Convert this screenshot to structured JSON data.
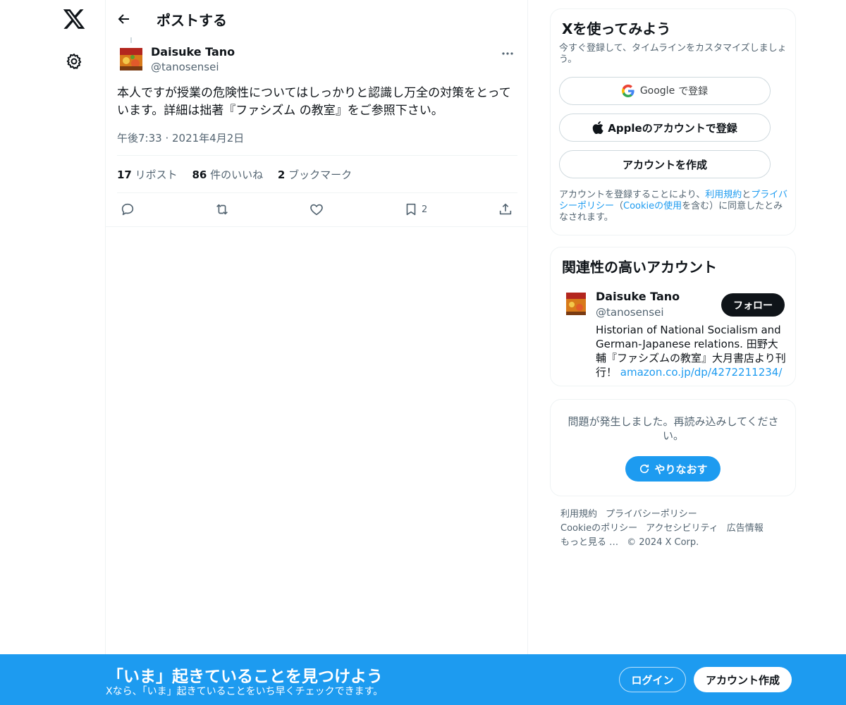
{
  "header": {
    "title": "ポストする"
  },
  "post": {
    "author_name": "Daisuke Tano",
    "author_handle": "@tanosensei",
    "text": "本人ですが授業の危険性についてはしっかりと認識し万全の対策をとっています。詳細は拙著『ファシズム の教室』をご参照下さい。",
    "timestamp": "午後7:33 · 2021年4月2日",
    "reposts_count": "17",
    "reposts_label": "リポスト",
    "likes_count": "86",
    "likes_label": "件のいいね",
    "bookmarks_count": "2",
    "bookmarks_label": "ブックマーク",
    "bookmark_action_count": "2"
  },
  "signup_card": {
    "title": "Xを使ってみよう",
    "subtitle": "今すぐ登録して、タイムラインをカスタマイズしましょう。",
    "google_brand": "Google",
    "google_label": "で登録",
    "apple_label": "Appleのアカウントで登録",
    "create_label": "アカウントを作成",
    "terms_prefix": "アカウントを登録することにより、",
    "terms_link": "利用規約",
    "terms_and": "と",
    "privacy_link": "プライバシーポリシー",
    "terms_mid": "（",
    "cookie_link": "Cookieの使用",
    "terms_suffix": "を含む）に同意したとみなされます。"
  },
  "related_card": {
    "title": "関連性の高いアカウント",
    "name": "Daisuke Tano",
    "handle": "@tanosensei",
    "follow_label": "フォロー",
    "bio": "Historian of National Socialism and German-Japanese relations. 田野大輔『ファシズムの教室』大月書店より刊行！",
    "bio_link": "amazon.co.jp/dp/4272211234/"
  },
  "error_card": {
    "message": "問題が発生しました。再読み込みしてください。",
    "retry_label": "やりなおす"
  },
  "footer": {
    "terms": "利用規約",
    "privacy": "プライバシーポリシー",
    "cookie": "Cookieのポリシー",
    "accessibility": "アクセシビリティ",
    "ads": "広告情報",
    "more": "もっと見る …",
    "copyright": "© 2024 X Corp."
  },
  "banner": {
    "title": "「いま」起きていることを見つけよう",
    "subtitle": "Xなら、「いま」起きていることをいち早くチェックできます。",
    "login_label": "ログイン",
    "signup_label": "アカウント作成"
  },
  "colors": {
    "accent": "#1d9bf0",
    "text": "#0f1419",
    "muted": "#536471",
    "border": "#eff3f4"
  },
  "icons": [
    "x-logo-icon",
    "gear-icon",
    "back-arrow-icon",
    "more-icon",
    "reply-icon",
    "repost-icon",
    "like-icon",
    "bookmark-icon",
    "share-icon",
    "google-icon",
    "apple-icon",
    "refresh-icon"
  ]
}
